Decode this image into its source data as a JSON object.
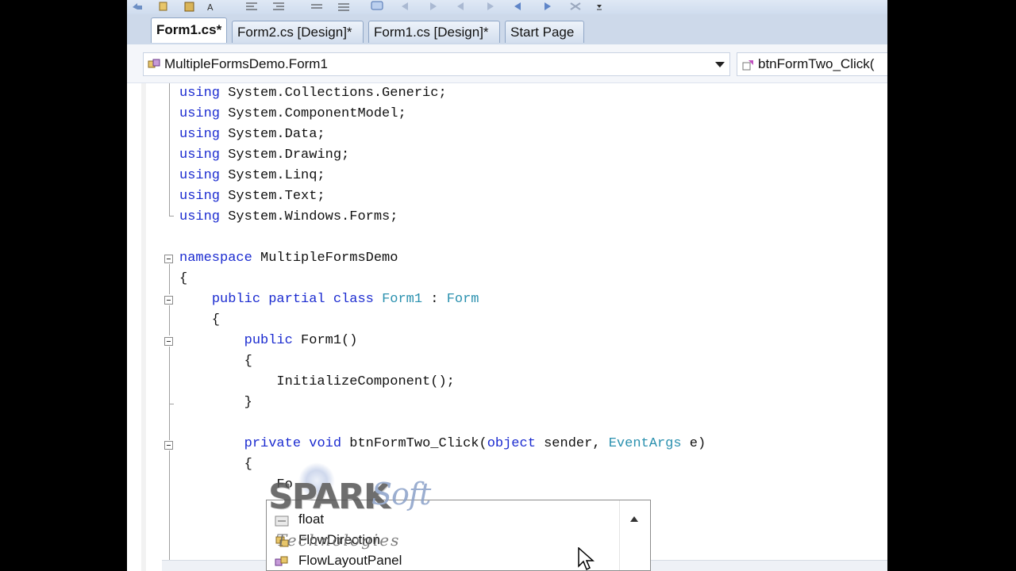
{
  "tabs": [
    {
      "label": "Form1.cs*",
      "active": true
    },
    {
      "label": "Form2.cs [Design]*",
      "active": false
    },
    {
      "label": "Form1.cs [Design]*",
      "active": false
    },
    {
      "label": "Start Page",
      "active": false
    }
  ],
  "nav": {
    "type_combo": "MultipleFormsDemo.Form1",
    "member_combo": "btnFormTwo_Click("
  },
  "code_lines": [
    {
      "t": [
        {
          "k": "kw",
          "s": "using"
        },
        {
          "k": "",
          "s": " System.Collections.Generic;"
        }
      ]
    },
    {
      "t": [
        {
          "k": "kw",
          "s": "using"
        },
        {
          "k": "",
          "s": " System.ComponentModel;"
        }
      ]
    },
    {
      "t": [
        {
          "k": "kw",
          "s": "using"
        },
        {
          "k": "",
          "s": " System.Data;"
        }
      ]
    },
    {
      "t": [
        {
          "k": "kw",
          "s": "using"
        },
        {
          "k": "",
          "s": " System.Drawing;"
        }
      ]
    },
    {
      "t": [
        {
          "k": "kw",
          "s": "using"
        },
        {
          "k": "",
          "s": " System.Linq;"
        }
      ]
    },
    {
      "t": [
        {
          "k": "kw",
          "s": "using"
        },
        {
          "k": "",
          "s": " System.Text;"
        }
      ]
    },
    {
      "t": [
        {
          "k": "kw",
          "s": "using"
        },
        {
          "k": "",
          "s": " System.Windows.Forms;"
        }
      ]
    },
    {
      "t": []
    },
    {
      "t": [
        {
          "k": "kw",
          "s": "namespace"
        },
        {
          "k": "",
          "s": " MultipleFormsDemo"
        }
      ]
    },
    {
      "t": [
        {
          "k": "",
          "s": "{"
        }
      ]
    },
    {
      "t": [
        {
          "k": "",
          "s": "    "
        },
        {
          "k": "kw",
          "s": "public partial class"
        },
        {
          "k": "",
          "s": " "
        },
        {
          "k": "ty",
          "s": "Form1"
        },
        {
          "k": "",
          "s": " : "
        },
        {
          "k": "ty",
          "s": "Form"
        }
      ]
    },
    {
      "t": [
        {
          "k": "",
          "s": "    {"
        }
      ]
    },
    {
      "t": [
        {
          "k": "",
          "s": "        "
        },
        {
          "k": "kw",
          "s": "public"
        },
        {
          "k": "",
          "s": " Form1()"
        }
      ]
    },
    {
      "t": [
        {
          "k": "",
          "s": "        {"
        }
      ]
    },
    {
      "t": [
        {
          "k": "",
          "s": "            InitializeComponent();"
        }
      ]
    },
    {
      "t": [
        {
          "k": "",
          "s": "        }"
        }
      ]
    },
    {
      "t": []
    },
    {
      "t": [
        {
          "k": "",
          "s": "        "
        },
        {
          "k": "kw",
          "s": "private void"
        },
        {
          "k": "",
          "s": " btnFormTwo_Click("
        },
        {
          "k": "kw",
          "s": "object"
        },
        {
          "k": "",
          "s": " sender, "
        },
        {
          "k": "ty",
          "s": "EventArgs"
        },
        {
          "k": "",
          "s": " e)"
        }
      ]
    },
    {
      "t": [
        {
          "k": "",
          "s": "        {"
        }
      ]
    },
    {
      "t": [
        {
          "k": "",
          "s": "            Fo"
        }
      ]
    }
  ],
  "completion": [
    {
      "label": "float",
      "icon": "keyword-icon"
    },
    {
      "label": "FlowDirection",
      "icon": "enum-icon"
    },
    {
      "label": "FlowLayoutPanel",
      "icon": "class-icon"
    }
  ],
  "watermark": {
    "main": "SPARK",
    "soft": "Soft",
    "sub": "Technologies"
  }
}
